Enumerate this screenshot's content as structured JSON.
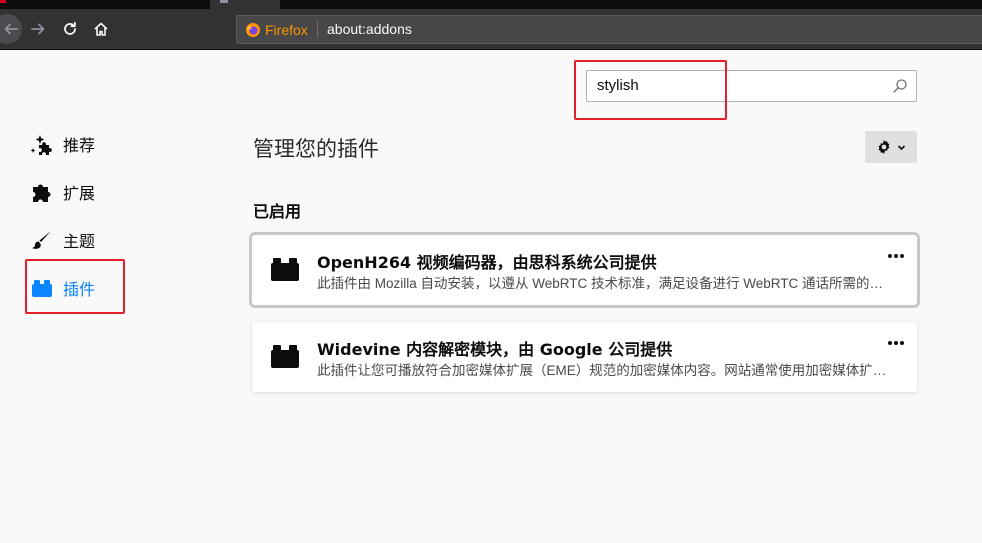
{
  "browser": {
    "identity_label": "Firefox",
    "url": "about:addons"
  },
  "search": {
    "value": "stylish"
  },
  "sidebar": {
    "items": [
      {
        "label": "推荐",
        "icon": "sparkle-puzzle-icon"
      },
      {
        "label": "扩展",
        "icon": "puzzle-icon"
      },
      {
        "label": "主题",
        "icon": "brush-icon"
      },
      {
        "label": "插件",
        "icon": "plugin-block-icon",
        "selected": true
      }
    ]
  },
  "main": {
    "title": "管理您的插件",
    "section_title": "已启用",
    "plugins": [
      {
        "name": "OpenH264 视频编码器，由思科系统公司提供",
        "description": "此插件由 Mozilla 自动安装，以遵从 WebRTC 技术标准，满足设备进行 WebRTC 通话所需的编解码需求。"
      },
      {
        "name": "Widevine 内容解密模块，由 Google 公司提供",
        "description": "此插件让您可播放符合加密媒体扩展（EME）规范的加密媒体内容。网站通常使用加密媒体扩展来防止复制高品质媒体内容。"
      }
    ]
  },
  "colors": {
    "accent": "#0a84ff",
    "highlight": "#e1202a",
    "firefox_orange": "#ff9400"
  }
}
